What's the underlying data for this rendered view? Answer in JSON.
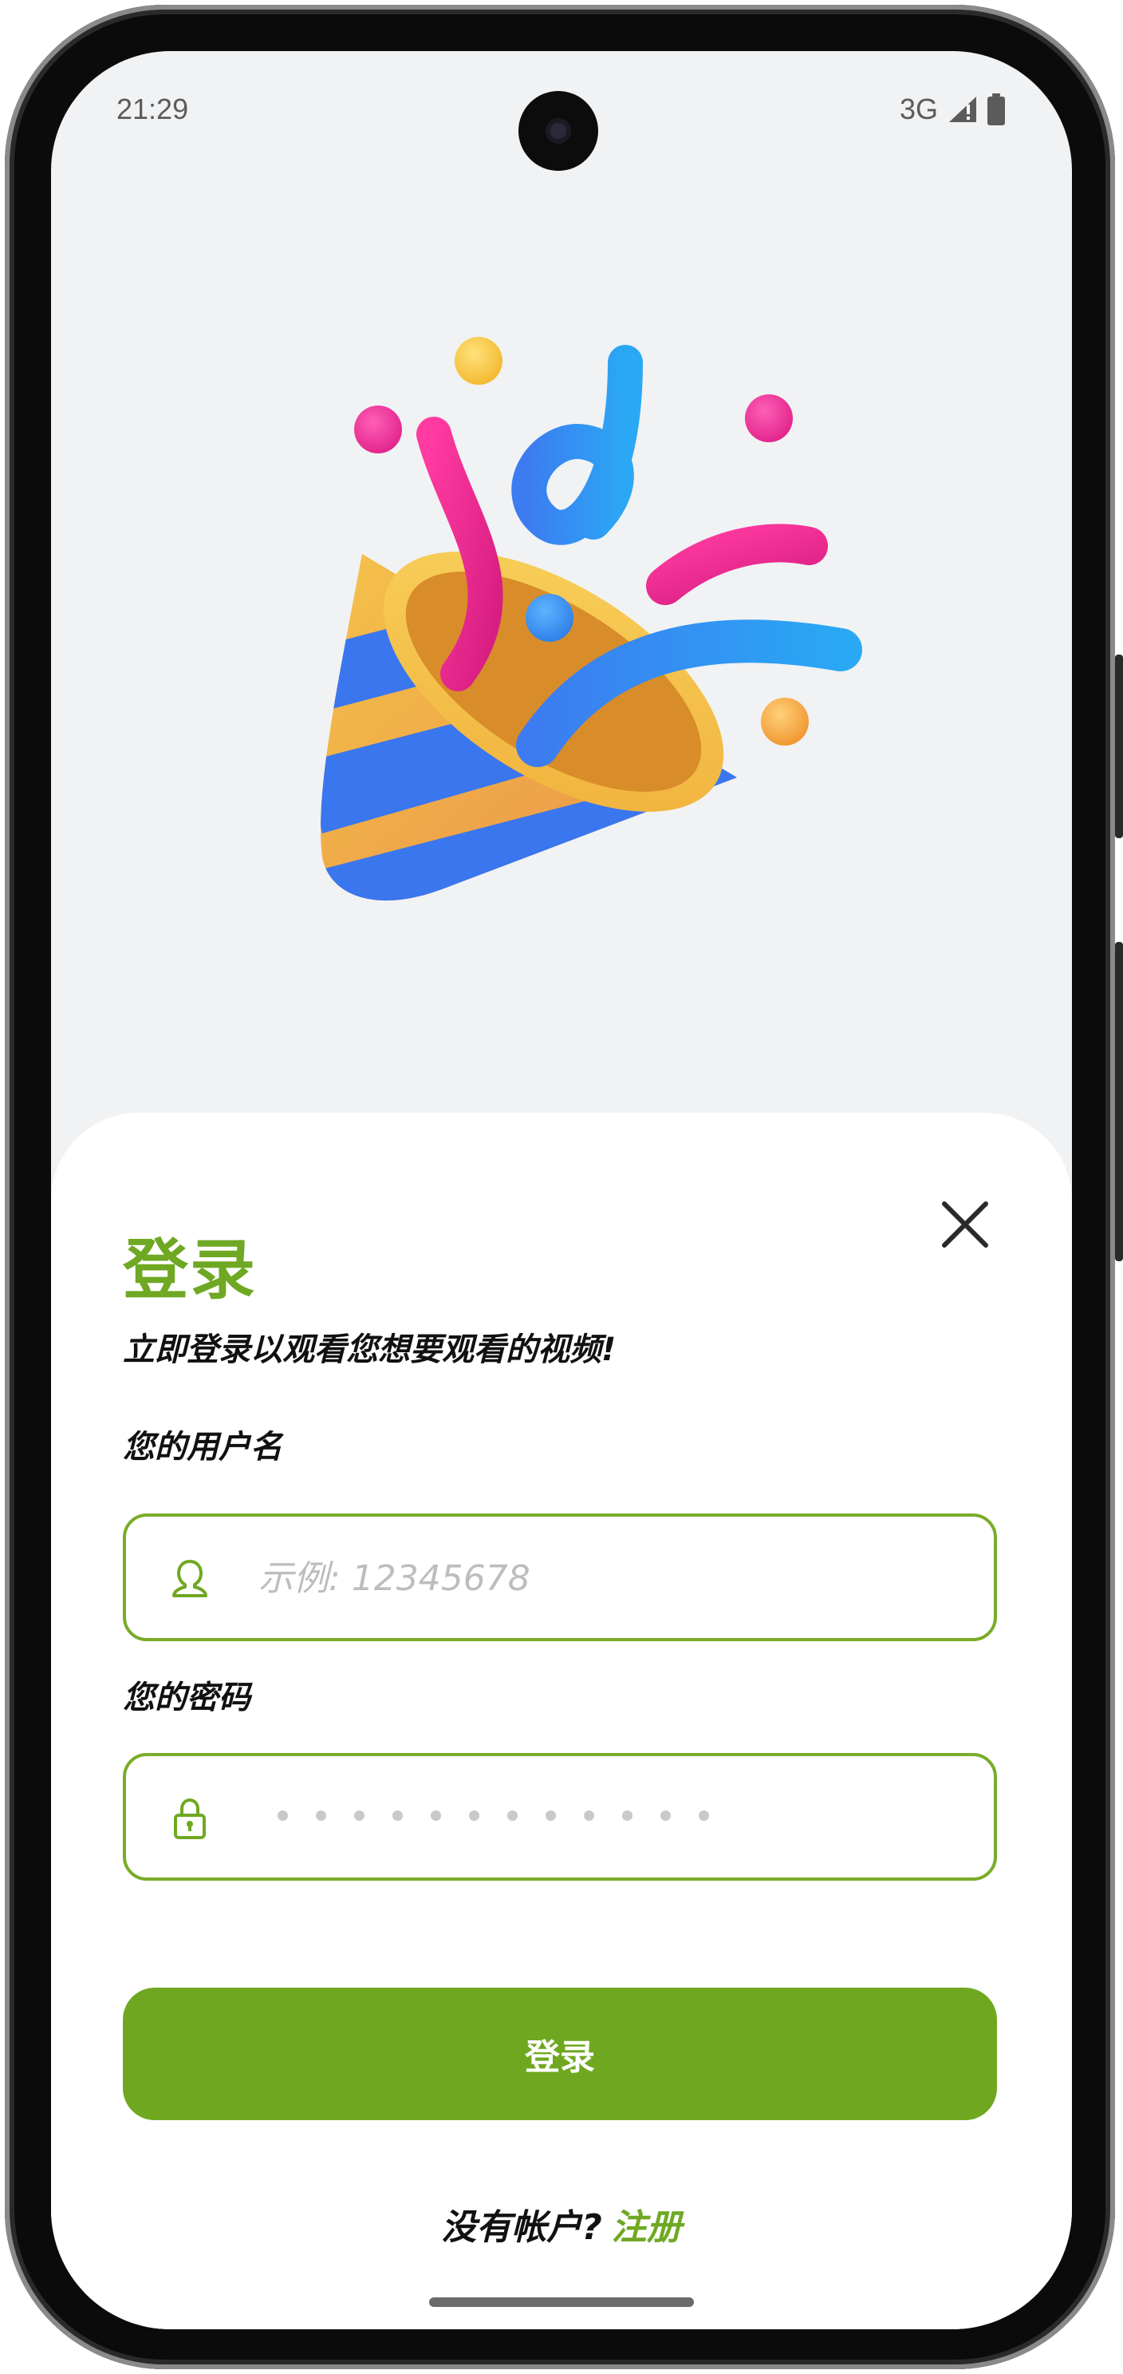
{
  "status_bar": {
    "time": "21:29",
    "network": "3G"
  },
  "illustration": {
    "icon": "party-popper-icon"
  },
  "login": {
    "title": "登录",
    "subtitle": "立即登录以观看您想要观看的视频!",
    "username_label": "您的用户名",
    "username_placeholder": "示例: 12345678",
    "password_label": "您的密码",
    "password_dot_count": 12,
    "submit_label": "登录",
    "signup_prompt": "没有帐户?",
    "signup_link": "注册"
  },
  "colors": {
    "accent": "#6fa822",
    "screen_background": "#f1f2f4",
    "sheet_background": "#ffffff"
  }
}
